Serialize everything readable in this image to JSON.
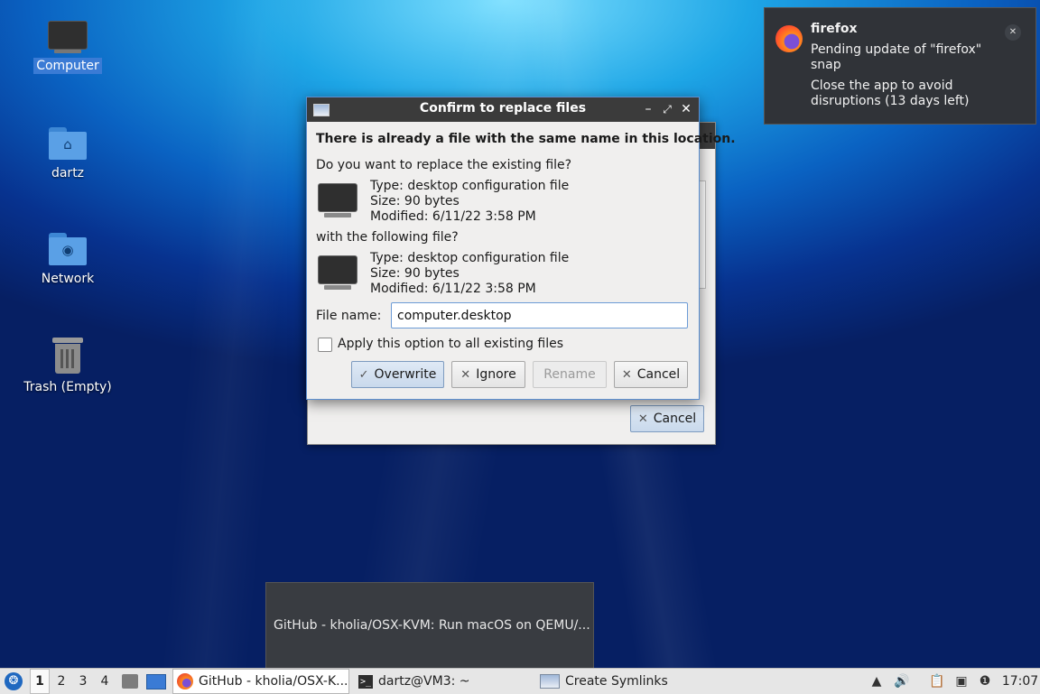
{
  "desktop": {
    "icons": [
      {
        "label": "Computer",
        "icon": "monitor-icon"
      },
      {
        "label": "dartz",
        "icon": "home-folder-icon"
      },
      {
        "label": "Network",
        "icon": "network-folder-icon"
      },
      {
        "label": "Trash (Empty)",
        "icon": "trash-icon"
      }
    ]
  },
  "bg_window": {
    "cancel_label": "Cancel"
  },
  "dialog": {
    "title": "Confirm to replace files",
    "heading": "There is already a file with the same name in this location.",
    "question": "Do you want to replace the existing file?",
    "existing": {
      "type": "Type: desktop configuration file",
      "size": "Size: 90 bytes",
      "modified": "Modified: 6/11/22 3:58 PM"
    },
    "with_label": "with the following file?",
    "new_file": {
      "type": "Type: desktop configuration file",
      "size": "Size: 90 bytes",
      "modified": "Modified: 6/11/22 3:58 PM"
    },
    "filename_label": "File name:",
    "filename_value": "computer.desktop",
    "apply_all_label": "Apply this option to all existing files",
    "buttons": {
      "overwrite": "Overwrite",
      "ignore": "Ignore",
      "rename": "Rename",
      "cancel": "Cancel"
    }
  },
  "notification": {
    "app": "firefox",
    "body_line1": "Pending update of \"firefox\" snap",
    "body_line2": "Close the app to avoid disruptions (13 days left)"
  },
  "tooltip": {
    "text": "GitHub - kholia/OSX-KVM: Run macOS on QEMU/..."
  },
  "taskbar": {
    "workspaces": [
      "1",
      "2",
      "3",
      "4"
    ],
    "active_workspace": "1",
    "tasks": [
      {
        "label": "GitHub - kholia/OSX-K...",
        "icon": "firefox-icon"
      },
      {
        "label": "dartz@VM3: ~",
        "icon": "terminal-icon"
      },
      {
        "label": "Create Symlinks",
        "icon": "window-icon"
      }
    ],
    "clock": "17:07"
  },
  "colors": {
    "accent": "#5b8fd1",
    "titlebar": "#3b3b3b",
    "selection": "#3a7bd5"
  }
}
